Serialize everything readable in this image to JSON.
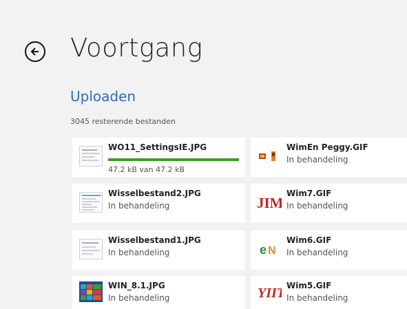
{
  "header": {
    "title": "Voortgang",
    "back_icon": "back-arrow-circle-icon"
  },
  "section": {
    "title": "Uploaden",
    "remaining": "3045 resterende bestanden"
  },
  "colors": {
    "accent": "#2d6fb7",
    "progress": "#3aa023",
    "background": "#f2f2f2",
    "tile": "#ffffff"
  },
  "uploads": [
    {
      "name": "WO11_SettingsIE.JPG",
      "status": "",
      "progress": 1.0,
      "size": "47.2 kB van 47.2 kB"
    },
    {
      "name": "WimEn Peggy.GIF",
      "status": "In behandeling"
    },
    {
      "name": "Wisselbestand2.JPG",
      "status": "In behandeling"
    },
    {
      "name": "Wim7.GIF",
      "status": "In behandeling"
    },
    {
      "name": "Wisselbestand1.JPG",
      "status": "In behandeling"
    },
    {
      "name": "Wim6.GIF",
      "status": "In behandeling"
    },
    {
      "name": "WIN_8.1.JPG",
      "status": "In behandeling"
    },
    {
      "name": "Wim5.GIF",
      "status": "In behandeling"
    }
  ]
}
